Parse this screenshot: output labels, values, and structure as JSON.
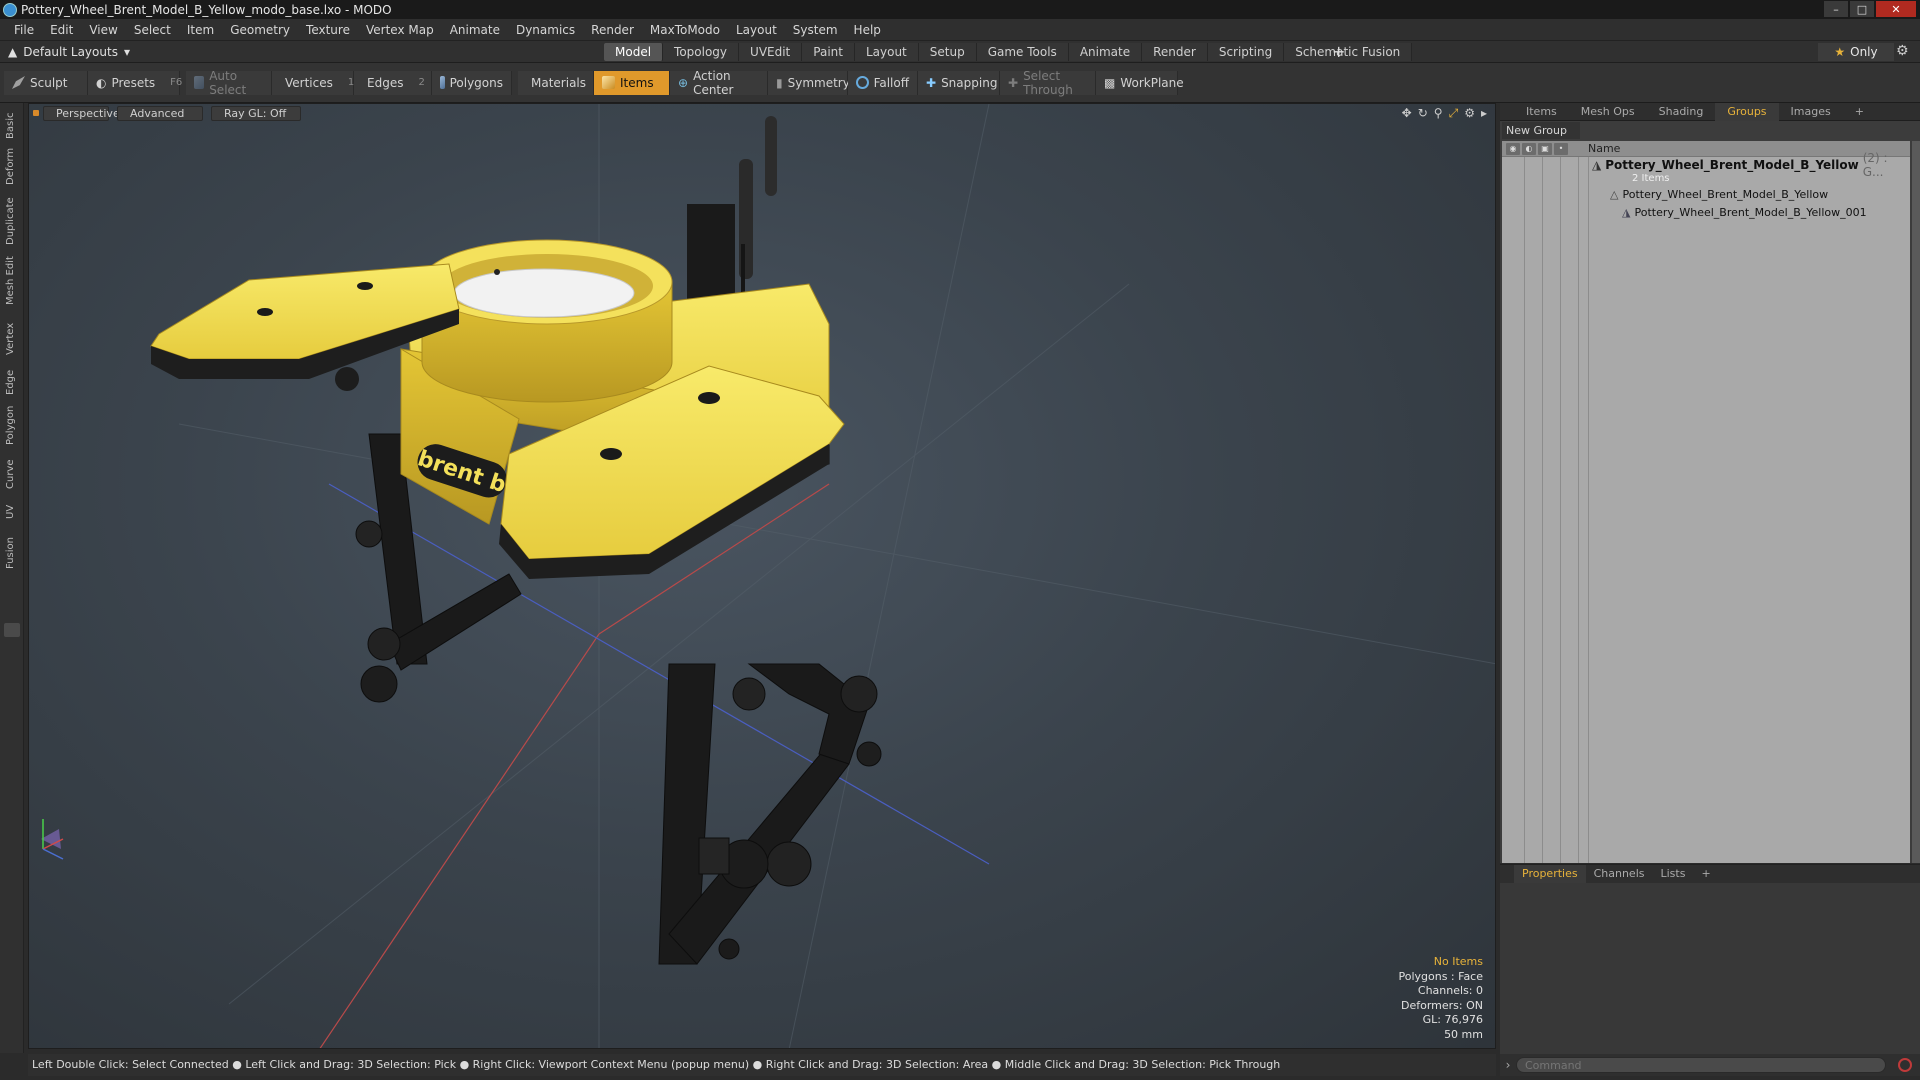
{
  "window": {
    "title": "Pottery_Wheel_Brent_Model_B_Yellow_modo_base.lxo - MODO"
  },
  "menu": [
    "File",
    "Edit",
    "View",
    "Select",
    "Item",
    "Geometry",
    "Texture",
    "Vertex Map",
    "Animate",
    "Dynamics",
    "Render",
    "MaxToModo",
    "Layout",
    "System",
    "Help"
  ],
  "layout": {
    "selector": "Default Layouts",
    "tabs": [
      "Model",
      "Topology",
      "UVEdit",
      "Paint",
      "Layout",
      "Setup",
      "Game Tools",
      "Animate",
      "Render",
      "Scripting",
      "Schematic Fusion"
    ],
    "active_tab": "Model",
    "only_label": "Only"
  },
  "toolbar": {
    "sculpt": "Sculpt",
    "presets": "Presets",
    "presets_key": "F6",
    "auto_select": "Auto Select",
    "vertices": "Vertices",
    "vertices_key": "1",
    "edges": "Edges",
    "edges_key": "2",
    "polygons": "Polygons",
    "materials": "Materials",
    "items": "Items",
    "action_center": "Action Center",
    "symmetry": "Symmetry",
    "falloff": "Falloff",
    "snapping": "Snapping",
    "select_through": "Select Through",
    "workplane": "WorkPlane"
  },
  "left_tabs": [
    "Basic",
    "Deform",
    "Duplicate",
    "Mesh Edit",
    "Vertex",
    "Edge",
    "Polygon",
    "Curve",
    "UV",
    "Fusion"
  ],
  "viewport": {
    "view": "Perspective",
    "mode": "Advanced",
    "raygl": "Ray GL: Off",
    "info": {
      "no_items": "No Items",
      "polygons": "Polygons : Face",
      "channels": "Channels: 0",
      "deformers": "Deformers: ON",
      "gl": "GL: 76,976",
      "scale": "50 mm"
    },
    "logo_text": "brent b"
  },
  "right_panel": {
    "tabs": [
      "Items",
      "Mesh Ops",
      "Shading",
      "Groups",
      "Images"
    ],
    "active_tab": "Groups",
    "new_group": "New Group",
    "name_header": "Name",
    "group": {
      "name": "Pottery_Wheel_Brent_Model_B_Yellow",
      "count": "(2) : G...",
      "sub": "2 Items"
    },
    "children": [
      "Pottery_Wheel_Brent_Model_B_Yellow",
      "Pottery_Wheel_Brent_Model_B_Yellow_001"
    ]
  },
  "properties_panel": {
    "tabs": [
      "Properties",
      "Channels",
      "Lists"
    ],
    "active_tab": "Properties"
  },
  "status": {
    "hint": "Left Double Click: Select Connected ● Left Click and Drag: 3D Selection: Pick ● Right Click: Viewport Context Menu (popup menu) ● Right Click and Drag: 3D Selection: Area ● Middle Click and Drag: 3D Selection: Pick Through",
    "command_placeholder": "Command"
  },
  "colors": {
    "accent": "#e0992b",
    "model_yellow": "#f3e05a",
    "dark_metal": "#1c1c1c"
  }
}
